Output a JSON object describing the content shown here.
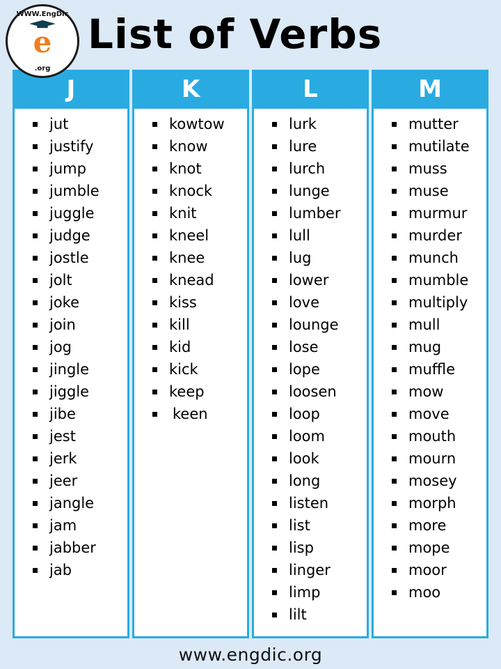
{
  "header": {
    "title": "List of Verbs",
    "logo": {
      "text_top": "WWW.EngDic",
      "text_bottom": ".org",
      "letter": "e",
      "icon": "graduation-cap-icon"
    }
  },
  "footer": {
    "website": "www.engdic.org"
  },
  "colors": {
    "accent": "#29abe2",
    "page_background": "#dce9f7",
    "card_background": "#ffffff",
    "text": "#000000",
    "logo_orange": "#f07d1e"
  },
  "columns": [
    {
      "letter": "J",
      "words": [
        "jut",
        "justify",
        "jump",
        "jumble",
        "juggle",
        "judge",
        "jostle",
        "jolt",
        "joke",
        "join",
        "jog",
        "jingle",
        "jiggle",
        "jibe",
        "jest",
        "jerk",
        "jeer",
        "jangle",
        "jam",
        "jabber",
        "jab"
      ]
    },
    {
      "letter": "K",
      "words": [
        "kowtow",
        "know",
        "knot",
        "knock",
        "knit",
        "kneel",
        "knee",
        "knead",
        "kiss",
        "kill",
        "kid",
        "kick",
        "keep",
        "keen"
      ]
    },
    {
      "letter": "L",
      "words": [
        "lurk",
        "lure",
        "lurch",
        "lunge",
        "lumber",
        "lull",
        "lug",
        "lower",
        "love",
        "lounge",
        "lose",
        "lope",
        "loosen",
        "loop",
        "loom",
        "look",
        "long",
        "listen",
        "list",
        "lisp",
        "linger",
        "limp",
        "lilt"
      ]
    },
    {
      "letter": "M",
      "words": [
        "mutter",
        "mutilate",
        "muss",
        "muse",
        "murmur",
        "murder",
        "munch",
        "mumble",
        "multiply",
        "mull",
        "mug",
        "muffle",
        "mow",
        "move",
        "mouth",
        "mourn",
        "mosey",
        "morph",
        "more",
        "mope",
        "moor",
        "moo"
      ]
    }
  ]
}
